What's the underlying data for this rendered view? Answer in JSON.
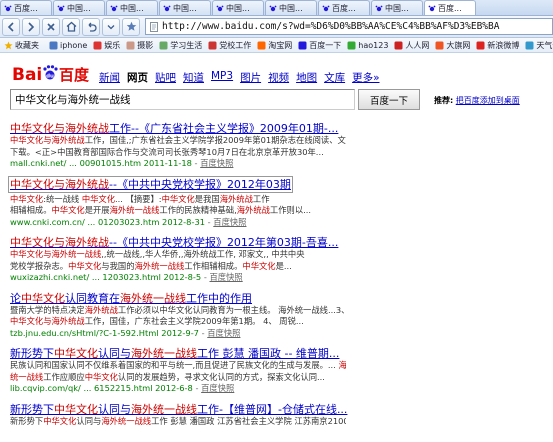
{
  "browser": {
    "tabs": [
      "百度...",
      "中国...",
      "中国...",
      "中国...",
      "中国...",
      "中国...",
      "百度...",
      "中国...",
      "百度..."
    ],
    "active_tab_index": 8,
    "url": "http://www.baidu.com/s?wd=%D6%D0%BB%AA%CE%C4%BB%AF%D3%EB%BA",
    "favorites": [
      "收藏夹",
      "iphone",
      "娱乐",
      "摄影",
      "学习生活",
      "党校工作",
      "淘宝网",
      "百度一下",
      "hao123",
      "人人网",
      "大旗网",
      "新浪微博",
      "天气预报"
    ]
  },
  "baidu": {
    "logo_text": "百度",
    "nav": [
      "新闻",
      "网页",
      "贴吧",
      "知道",
      "MP3",
      "图片",
      "视频",
      "地图",
      "文库",
      "更多»"
    ],
    "nav_current": "网页",
    "query": "中华文化与海外统一战线",
    "search_button": "百度一下",
    "tip_label": "推荐:",
    "tip_link": "把百度添加到桌面"
  },
  "results": [
    {
      "title_html": "<em>中华文化与海外统战</em>工作--《广东省社会主义学报》2009年01期-...",
      "snippet_html": [
        "<em>中华文化与海外统战</em>工作，国佳,;广东省社会主义学院学报2009年第01期杂志在线阅读、文章",
        "下载。<正>中国教育部国际合作与交流司司长张秀琴10月7日在北京京革开放30年..."
      ],
      "url": "mall.cnki.net/ ... 00901015.htm 2011-11-18",
      "cache": "百度快照",
      "boxed": false
    },
    {
      "title_html": "<em>中华文化与海外统战</em>--《中共中央党校学报》2012年03期",
      "snippet_html": [
        "<em>中华文化</em>:统一战线 <em>中华文化</em>... 【摘要】:<em>中华文化</em>是我国<em>海外统战</em>工作",
        "相辅相成。<em>中华文化</em>是开展<em>海外统一战线</em>工作的民族精神基础,<em>海外统战</em>工作则以..."
      ],
      "url": "www.cnki.com.cn/ ... 01203023.htm 2012-8-31",
      "cache": "百度快照",
      "boxed": true
    },
    {
      "title_html": "<em>中华文化与海外统战</em>--《中共中央党校学报》2012年第03期-吾喜...",
      "snippet_html": [
        "<em>中华文化与海外统一战线</em>,,统一战线,,华人华侨,,海外统战工作, 邓家文,, 中共中央",
        "党校学报杂志。<em>中华文化</em>与我国的<em>海外统一战线</em>工作相辅相成。<em>中华文化</em>是..."
      ],
      "url": "wuxizazhi.cnki.net/ ... 1203023.html 2012-8-5",
      "cache": "百度快照",
      "boxed": false
    },
    {
      "title_html": "论<em>中华文化</em>认同教育在<em>海外统一战线</em>工作中的作用",
      "snippet_html": [
        "暨南大学的特点决定<em>海外统战</em>工作必须以中华文化认同教育为一根主线。 海外统一战线...3、",
        "<em>中华文化与海外统战</em>工作，国佳，广东社会主义学院2009年第1期。 4、 周锐..."
      ],
      "url": "tzb.jnu.edu.cn/sHtml/?C-1-592.Html 2012-9-7",
      "cache": "百度快照",
      "boxed": false
    },
    {
      "title_html": "新形势下<em>中华文化</em>认同与<em>海外统一战线</em>工作 彭慧 潘国政 -- 维普期...",
      "snippet_html": [
        "民族认同和国家认同不仅维系着国家的和平与统一,而且促进了民族文化的生成与发展。... <em>海外</em>",
        "<em>统一战线</em>工作应顺应<em>中华文化</em>认同的发展趋势，寻求文化认同的方式，探索文化认同..."
      ],
      "url": "lib.cqvip.com/qk/ ... 6152215.html 2012-6-8",
      "cache": "百度快照",
      "boxed": false
    },
    {
      "title_html": "新形势下<em>中华文化</em>认同与<em>海外统一战线</em>工作-【维普网】-仓储式在线...",
      "snippet_html": [
        "新形势下<em>中华文化</em>认同与<em>海外统一战线</em>工作 彭慧 潘国政 江苏省社会主义学院 江苏南京210007"
      ],
      "url": "",
      "cache": "",
      "boxed": false
    }
  ],
  "colors": {
    "link": "#0000cc",
    "highlight": "#cc0000",
    "url_green": "#008000",
    "logo_red": "#e10602",
    "logo_blue": "#2319dc"
  }
}
